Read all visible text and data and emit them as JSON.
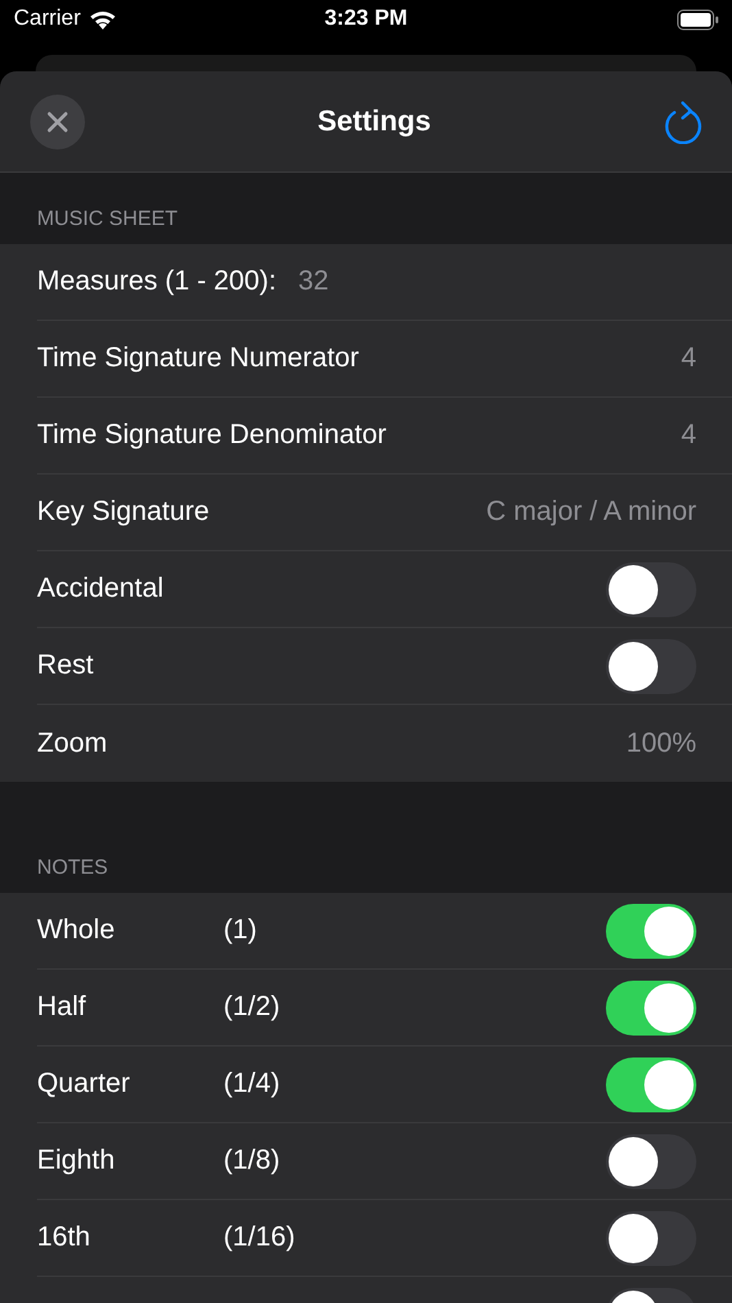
{
  "status_bar": {
    "carrier": "Carrier",
    "time": "3:23 PM"
  },
  "header": {
    "title": "Settings"
  },
  "music_sheet": {
    "title": "MUSIC SHEET",
    "rows": [
      {
        "kind": "input",
        "label": "Measures (1 - 200):",
        "value": "32"
      },
      {
        "kind": "value",
        "label": "Time Signature Numerator",
        "value": "4"
      },
      {
        "kind": "value",
        "label": "Time Signature Denominator",
        "value": "4"
      },
      {
        "kind": "value",
        "label": "Key Signature",
        "value": "C major / A minor"
      },
      {
        "kind": "toggle",
        "label": "Accidental",
        "on": false
      },
      {
        "kind": "toggle",
        "label": "Rest",
        "on": false
      },
      {
        "kind": "value",
        "label": "Zoom",
        "value": "100%"
      }
    ]
  },
  "notes": {
    "title": "NOTES",
    "rows": [
      {
        "name": "Whole",
        "fraction": "(1)",
        "on": true
      },
      {
        "name": "Half",
        "fraction": "(1/2)",
        "on": true
      },
      {
        "name": "Quarter",
        "fraction": "(1/4)",
        "on": true
      },
      {
        "name": "Eighth",
        "fraction": "(1/8)",
        "on": false
      },
      {
        "name": "16th",
        "fraction": "(1/16)",
        "on": false
      },
      {
        "on": false
      }
    ]
  }
}
